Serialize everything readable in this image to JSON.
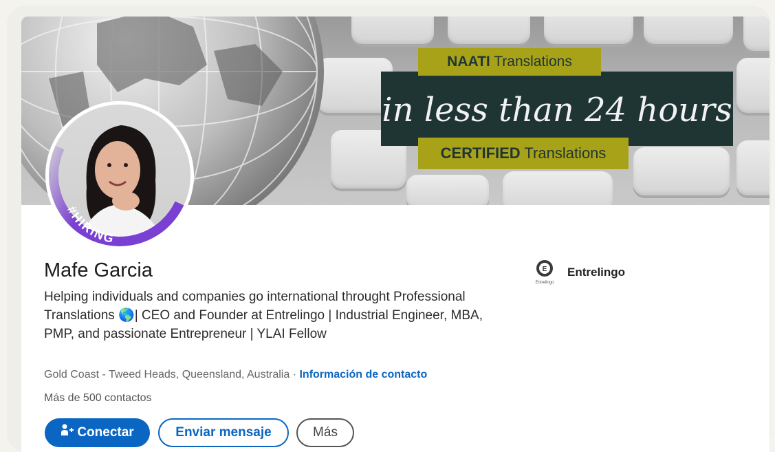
{
  "banner": {
    "top_label_bold": "NAATI",
    "top_label_rest": " Translations",
    "tagline": "in less than 24 hours",
    "bottom_label_bold": "CERTIFIED",
    "bottom_label_rest": " Translations"
  },
  "profile": {
    "avatar_frame": "#HIRING",
    "name": "Mafe Garcia",
    "headline": "Helping individuals and companies go international throught Professional Translations 🌎| CEO and Founder at Entrelingo | Industrial Engineer, MBA, PMP, and passionate Entrepreneur | YLAI Fellow",
    "location": "Gold Coast - Tweed Heads, Queensland, Australia",
    "separator": " · ",
    "contact_link": "Información de contacto",
    "contacts": "Más de 500 contactos",
    "company": "Entrelingo",
    "company_logo_text": "Entrelingo"
  },
  "actions": {
    "connect": "Conectar",
    "message": "Enviar mensaje",
    "more": "Más"
  },
  "colors": {
    "primary": "#0a66c2",
    "badge_dark": "#1f3534",
    "badge_olive": "#a8a218",
    "hiring_purple": "#7a3fd3"
  }
}
